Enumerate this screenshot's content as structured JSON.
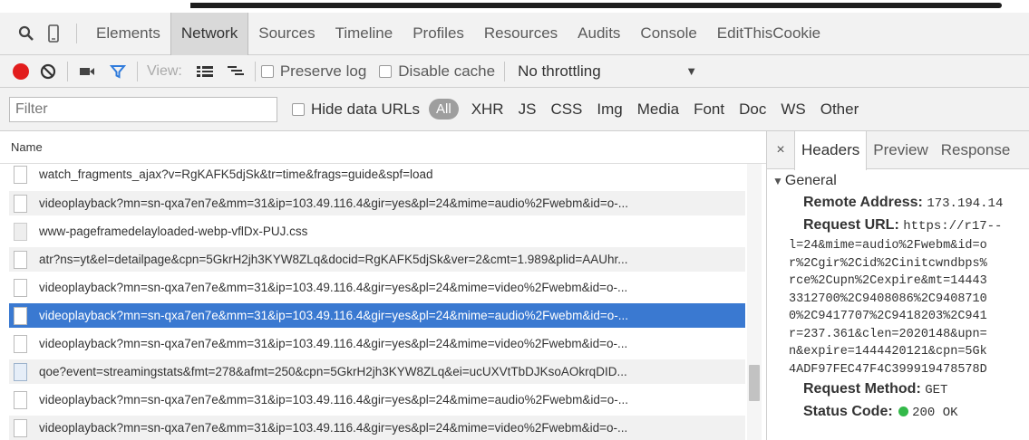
{
  "tabs": {
    "items": [
      "Elements",
      "Network",
      "Sources",
      "Timeline",
      "Profiles",
      "Resources",
      "Audits",
      "Console",
      "EditThisCookie"
    ],
    "active": "Network"
  },
  "toolbar": {
    "view_label": "View:",
    "preserve_log": "Preserve log",
    "disable_cache": "Disable cache",
    "throttling": "No throttling"
  },
  "filter": {
    "placeholder": "Filter",
    "hide_data_urls": "Hide data URLs",
    "all_label": "All",
    "types": [
      "XHR",
      "JS",
      "CSS",
      "Img",
      "Media",
      "Font",
      "Doc",
      "WS",
      "Other"
    ]
  },
  "list": {
    "header": "Name",
    "rows": [
      {
        "name": "watch_fragments_ajax?v=RgKAFK5djSk&tr=time&frags=guide&spf=load"
      },
      {
        "name": "videoplayback?mn=sn-qxa7en7e&mm=31&ip=103.49.116.4&gir=yes&pl=24&mime=audio%2Fwebm&id=o-..."
      },
      {
        "name": "www-pageframedelayloaded-webp-vflDx-PUJ.css"
      },
      {
        "name": "atr?ns=yt&el=detailpage&cpn=5GkrH2jh3KYW8ZLq&docid=RgKAFK5djSk&ver=2&cmt=1.989&plid=AAUhr..."
      },
      {
        "name": "videoplayback?mn=sn-qxa7en7e&mm=31&ip=103.49.116.4&gir=yes&pl=24&mime=video%2Fwebm&id=o-..."
      },
      {
        "name": "videoplayback?mn=sn-qxa7en7e&mm=31&ip=103.49.116.4&gir=yes&pl=24&mime=audio%2Fwebm&id=o-..."
      },
      {
        "name": "videoplayback?mn=sn-qxa7en7e&mm=31&ip=103.49.116.4&gir=yes&pl=24&mime=video%2Fwebm&id=o-..."
      },
      {
        "name": "qoe?event=streamingstats&fmt=278&afmt=250&cpn=5GkrH2jh3KYW8ZLq&ei=ucUXVtTbDJKsoAOkrqDID..."
      },
      {
        "name": "videoplayback?mn=sn-qxa7en7e&mm=31&ip=103.49.116.4&gir=yes&pl=24&mime=audio%2Fwebm&id=o-..."
      },
      {
        "name": "videoplayback?mn=sn-qxa7en7e&mm=31&ip=103.49.116.4&gir=yes&pl=24&mime=video%2Fwebm&id=o-..."
      }
    ]
  },
  "details": {
    "close": "×",
    "tabs": [
      "Headers",
      "Preview",
      "Response"
    ],
    "general_label": "General",
    "remote_address_label": "Remote Address:",
    "remote_address_value": "173.194.14",
    "request_url_label": "Request URL:",
    "request_url_value": "https://r17--",
    "url_lines": [
      "l=24&mime=audio%2Fwebm&id=o",
      "r%2Cgir%2Cid%2Cinitcwndbps%",
      "rce%2Cupn%2Cexpire&mt=14443",
      "3312700%2C9408086%2C9408710",
      "0%2C9417707%2C9418203%2C941",
      "r=237.361&clen=2020148&upn=",
      "n&expire=1444420121&cpn=5Gk",
      "4ADF97FEC47F4C399919478578D"
    ],
    "request_method_label": "Request Method:",
    "request_method_value": "GET",
    "status_code_label": "Status Code:",
    "status_code_value": "200 OK"
  },
  "colors": {
    "record": "#e21d1d",
    "selected_row": "#3a79d1",
    "status_ok": "#33b949",
    "filter_icon": "#2f7bdc"
  }
}
